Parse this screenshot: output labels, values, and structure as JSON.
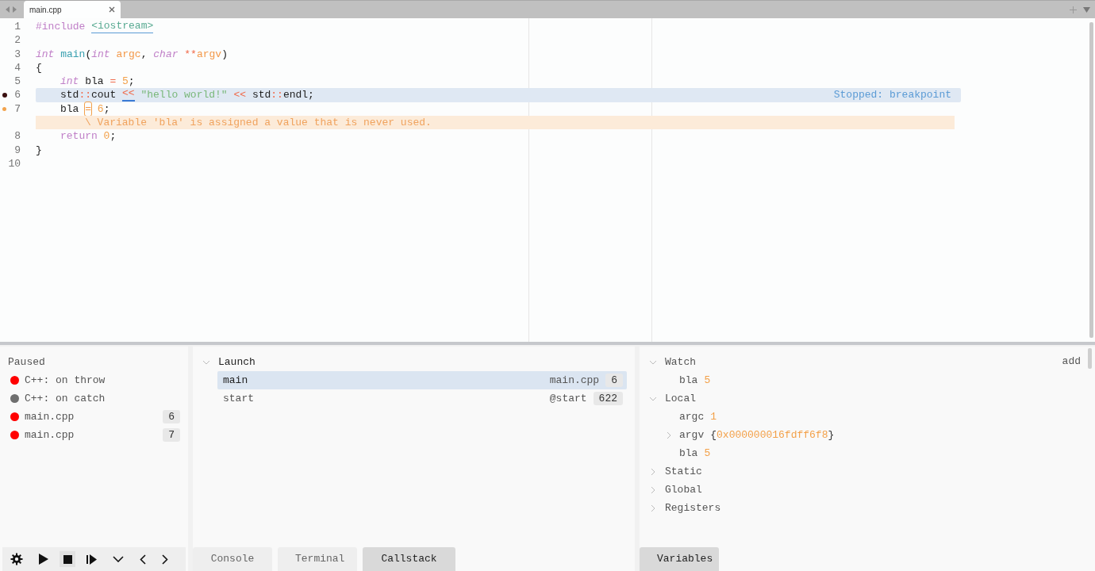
{
  "tab_bar": {
    "tabs": [
      {
        "title": "main.cpp",
        "selected": true
      }
    ]
  },
  "editor": {
    "lines": [
      {
        "kind": "code",
        "number": "1",
        "breakpoint": false,
        "warning": false,
        "indented": false,
        "highlight": false,
        "tokens": [
          {
            "kind": "directive",
            "text": "#include "
          },
          {
            "kind": "header",
            "text": "<iostream>"
          }
        ]
      },
      {
        "kind": "code",
        "number": "2",
        "breakpoint": false,
        "warning": false,
        "highlight": false
      },
      {
        "kind": "code",
        "number": "3",
        "breakpoint": false,
        "warning": false,
        "indented": false,
        "highlight": false,
        "tokens": [
          {
            "kind": "type",
            "text": "int "
          },
          {
            "kind": "function",
            "text": "main"
          },
          {
            "kind": "plain",
            "text": "("
          },
          {
            "kind": "type",
            "text": "int "
          },
          {
            "kind": "param",
            "text": "argc"
          },
          {
            "kind": "plain",
            "text": ", "
          },
          {
            "kind": "type",
            "text": "char "
          },
          {
            "kind": "operator",
            "text": "**"
          },
          {
            "kind": "param",
            "text": "argv"
          },
          {
            "kind": "plain",
            "text": ")"
          }
        ]
      },
      {
        "kind": "code",
        "number": "4",
        "breakpoint": false,
        "warning": false,
        "indented": false,
        "highlight": false,
        "tokens": [
          {
            "kind": "plain",
            "text": "{"
          }
        ]
      },
      {
        "kind": "code",
        "number": "5",
        "breakpoint": false,
        "warning": false,
        "indented": true,
        "highlight": false,
        "tokens": [
          {
            "kind": "type",
            "text": "int "
          },
          {
            "kind": "plain",
            "text": "bla "
          },
          {
            "kind": "operator",
            "text": "= "
          },
          {
            "kind": "number",
            "text": "5"
          },
          {
            "kind": "plain",
            "text": ";"
          }
        ]
      },
      {
        "kind": "code",
        "number": "6",
        "breakpoint": true,
        "warning": false,
        "indented": true,
        "highlight": true,
        "annotation": "Stopped: breakpoint",
        "tokens": [
          {
            "kind": "plain",
            "text": "std"
          },
          {
            "kind": "operator",
            "text": "::"
          },
          {
            "kind": "plain",
            "text": "cout "
          },
          {
            "kind": "cursor-operator",
            "text": "<<"
          },
          {
            "kind": "string",
            "text": " \"hello world!\" "
          },
          {
            "kind": "operator",
            "text": "<<"
          },
          {
            "kind": "plain",
            "text": " std"
          },
          {
            "kind": "operator",
            "text": "::"
          },
          {
            "kind": "plain",
            "text": "endl;"
          }
        ]
      },
      {
        "kind": "code",
        "number": "7",
        "breakpoint": false,
        "warning": true,
        "indented": true,
        "highlight": false,
        "tokens": [
          {
            "kind": "plain",
            "text": "bla "
          },
          {
            "kind": "flagged",
            "text": "="
          },
          {
            "kind": "number",
            "text": " 6"
          },
          {
            "kind": "plain",
            "text": ";"
          }
        ]
      },
      {
        "kind": "diagnostic",
        "text": "\\ Variable 'bla' is assigned a value that is never used."
      },
      {
        "kind": "code",
        "number": "8",
        "breakpoint": false,
        "warning": false,
        "indented": true,
        "highlight": false,
        "tokens": [
          {
            "kind": "keyword",
            "text": "return "
          },
          {
            "kind": "number",
            "text": "0"
          },
          {
            "kind": "plain",
            "text": ";"
          }
        ]
      },
      {
        "kind": "code",
        "number": "9",
        "breakpoint": false,
        "warning": false,
        "indented": false,
        "highlight": false,
        "tokens": [
          {
            "kind": "plain",
            "text": "}"
          }
        ]
      },
      {
        "kind": "code",
        "number": "10",
        "breakpoint": false,
        "warning": false,
        "highlight": false
      }
    ]
  },
  "breakpoints": {
    "title": "Paused",
    "items": [
      {
        "label": "C++: on throw",
        "color": "#ff0000"
      },
      {
        "label": "C++: on catch",
        "color": "#6e6e6e"
      },
      {
        "label": "main.cpp",
        "color": "#ff0000",
        "line": "6"
      },
      {
        "label": "main.cpp",
        "color": "#ff0000",
        "line": "7"
      }
    ]
  },
  "callstack": {
    "title": "Launch",
    "expanded": true,
    "frames": [
      {
        "name": "main",
        "file": "main.cpp",
        "line": "6",
        "selected": true
      },
      {
        "name": "start",
        "file": "@start",
        "line": "622",
        "selected": false
      }
    ]
  },
  "bottom_tabs": [
    {
      "label": "Console",
      "selected": false
    },
    {
      "label": "Terminal",
      "selected": false
    },
    {
      "label": "Callstack",
      "selected": true
    }
  ],
  "variables": {
    "add": "add",
    "groups": [
      {
        "label": "Watch",
        "expanded": true,
        "children": [
          {
            "name": "bla",
            "value": "5",
            "expandable": false
          }
        ]
      },
      {
        "label": "Local",
        "expanded": true,
        "children": [
          {
            "name": "argc",
            "value": "1",
            "expandable": false
          },
          {
            "name": "argv",
            "prefix": "{",
            "value": "0x000000016fdff6f8",
            "suffix": "}",
            "expandable": true
          },
          {
            "name": "bla",
            "value": "5",
            "expandable": false
          }
        ]
      },
      {
        "label": "Static",
        "expanded": false
      },
      {
        "label": "Global",
        "expanded": false
      },
      {
        "label": "Registers",
        "expanded": false
      }
    ],
    "tabs": [
      {
        "label": "Variables",
        "selected": true
      }
    ]
  }
}
